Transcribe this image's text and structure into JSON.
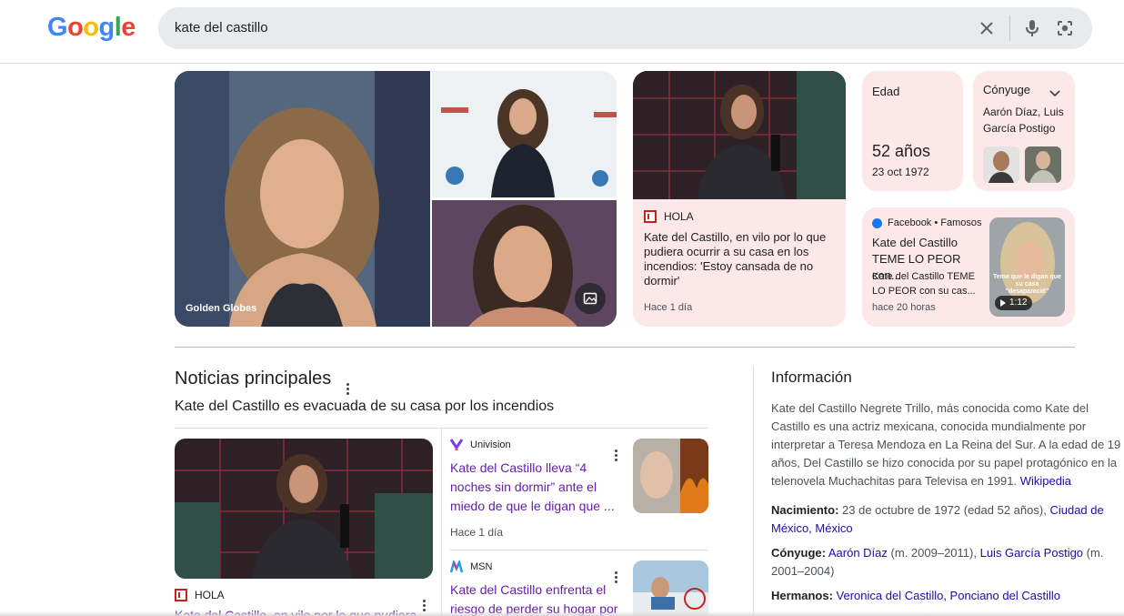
{
  "logo": {
    "letters": [
      "G",
      "o",
      "o",
      "g",
      "l",
      "e"
    ],
    "colors": [
      "#4285f4",
      "#ea4335",
      "#fbbc05",
      "#4285f4",
      "#34a853",
      "#ea4335"
    ]
  },
  "search": {
    "query": "kate del castillo",
    "clear_icon": "close-icon",
    "mic_icon": "mic-icon",
    "lens_icon": "camera-lens-icon"
  },
  "images": {
    "main_caption": "Golden Globes"
  },
  "hola_card": {
    "source": "HOLA",
    "headline": "Kate del Castillo, en vilo por lo que pudiera ocurrir a su casa en los incendios: 'Estoy cansada de no dormir'",
    "time": "Hace 1 día"
  },
  "age_card": {
    "label": "Edad",
    "value": "52 años",
    "date": "23 oct 1972"
  },
  "spouse_card": {
    "label": "Cónyuge",
    "names": "Aarón Díaz, Luis García Postigo"
  },
  "fb_card": {
    "source": "Facebook • Famosos",
    "title": "Kate del Castillo TEME LO PEOR con...",
    "snippet": "Kate del Castillo TEME LO PEOR con su cas...",
    "time": "hace 20 horas",
    "duration": "1:12",
    "thumb_text": "Teme que le digan que su casa \"desapareció\""
  },
  "news": {
    "heading": "Noticias principales",
    "subheading": "Kate del Castillo es evacuada de su casa por los incendios",
    "main": {
      "source": "HOLA",
      "title": "Kate del Castillo, en vilo por lo que pudiera"
    },
    "items": [
      {
        "source": "Univision",
        "title": "Kate del Castillo lleva “4 noches sin dormir” ante el miedo de que le digan que ...",
        "time": "Hace 1 día"
      },
      {
        "source": "MSN",
        "title": "Kate del Castillo enfrenta el riesgo de perder su hogar por"
      }
    ]
  },
  "info": {
    "heading": "Información",
    "description": "Kate del Castillo Negrete Trillo, más conocida como Kate del Castillo es una actriz mexicana, conocida mundialmente por interpretar a Teresa Mendoza en La Reina del Sur. A la edad de 19 años, Del Castillo se hizo conocida por su papel protagónico en la telenovela Muchachitas para Televisa en 1991.",
    "wiki": "Wikipedia",
    "birth_label": "Nacimiento:",
    "birth_value": "23 de octubre de 1972 (edad 52 años),",
    "birth_place": "Ciudad de México, México",
    "spouse_label": "Cónyuge:",
    "spouse1": "Aarón Díaz",
    "spouse1_years": "(m. 2009–2011),",
    "spouse2": "Luis García Postigo",
    "spouse2_years": "(m. 2001–2004)",
    "siblings_label": "Hermanos:",
    "siblings": "Veronica del Castillo, Ponciano del Castillo"
  },
  "colors": {
    "card_bg": "#fce8e8",
    "link": "#681da8",
    "blue": "#1a0dab"
  }
}
